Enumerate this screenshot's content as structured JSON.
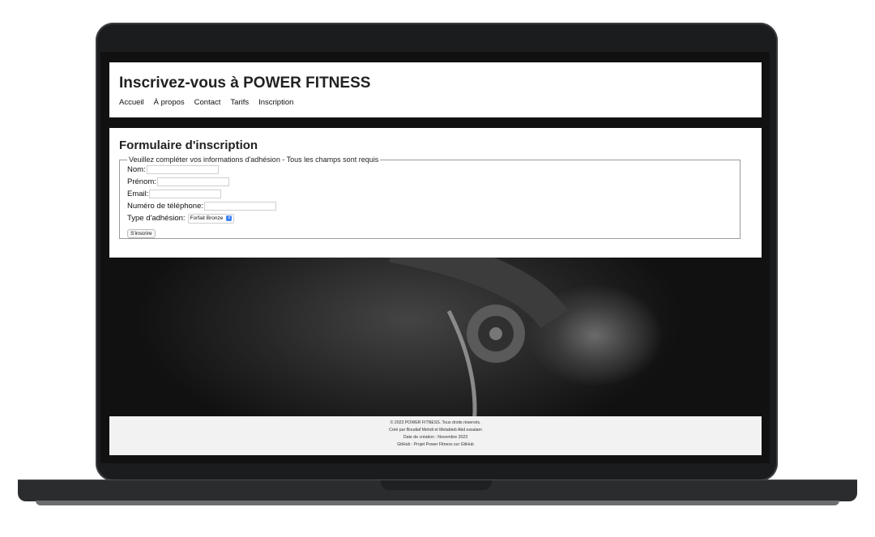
{
  "header": {
    "title": "Inscrivez-vous à POWER FITNESS",
    "nav": [
      "Accueil",
      "À propos",
      "Contact",
      "Tarifs",
      "Inscription"
    ]
  },
  "form": {
    "title": "Formulaire d'inscription",
    "legend": "Veuillez compléter vos informations d'adhésion - Tous les champs sont requis",
    "fields": {
      "nom": "Nom:",
      "prenom": "Prénom:",
      "email": "Email:",
      "telephone": "Numéro de téléphone:",
      "type": "Type d'adhésion:"
    },
    "membership_value": "Forfait Bronze",
    "submit": "S'inscrire"
  },
  "footer": {
    "line1": "© 2023 POWER FITNESS. Tous droits réservés.",
    "line2": "Créé par Boudiaf Mehdi et Metabteb Abd essalam",
    "line3": "Date de création : Novembre 2023",
    "line4": "GitHub : Projet Power Fitness sur GitHub"
  },
  "colors": {
    "frame": "#1b1c1e",
    "select_accent": "#3b82f6",
    "footer_bg": "#f2f2f2"
  }
}
